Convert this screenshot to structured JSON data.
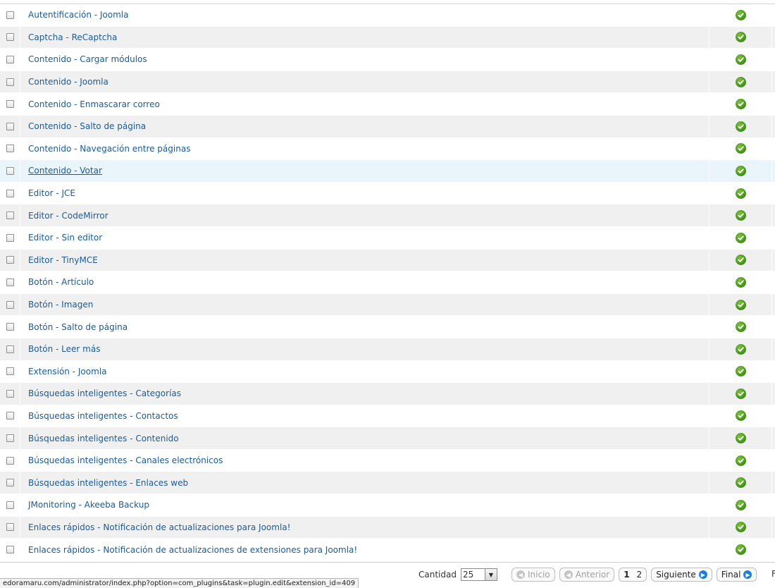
{
  "plugins": [
    {
      "name": "Autentificación - Joomla",
      "enabled": true
    },
    {
      "name": "Captcha - ReCaptcha",
      "enabled": true
    },
    {
      "name": "Contenido - Cargar módulos",
      "enabled": true
    },
    {
      "name": "Contenido - Joomla",
      "enabled": true
    },
    {
      "name": "Contenido - Enmascarar correo",
      "enabled": true
    },
    {
      "name": "Contenido - Salto de página",
      "enabled": true
    },
    {
      "name": "Contenido - Navegación entre páginas",
      "enabled": true
    },
    {
      "name": "Contenido - Votar",
      "enabled": true
    },
    {
      "name": "Editor - JCE",
      "enabled": true
    },
    {
      "name": "Editor - CodeMirror",
      "enabled": true
    },
    {
      "name": "Editor - Sin editor",
      "enabled": true
    },
    {
      "name": "Editor - TinyMCE",
      "enabled": true
    },
    {
      "name": "Botón - Artículo",
      "enabled": true
    },
    {
      "name": "Botón - Imagen",
      "enabled": true
    },
    {
      "name": "Botón - Salto de página",
      "enabled": true
    },
    {
      "name": "Botón - Leer más",
      "enabled": true
    },
    {
      "name": "Extensión - Joomla",
      "enabled": true
    },
    {
      "name": "Búsquedas inteligentes - Categorías",
      "enabled": true
    },
    {
      "name": "Búsquedas inteligentes - Contactos",
      "enabled": true
    },
    {
      "name": "Búsquedas inteligentes - Contenido",
      "enabled": true
    },
    {
      "name": "Búsquedas inteligentes - Canales electrónicos",
      "enabled": true
    },
    {
      "name": "Búsquedas inteligentes - Enlaces web",
      "enabled": true
    },
    {
      "name": "JMonitoring - Akeeba Backup",
      "enabled": true
    },
    {
      "name": "Enlaces rápidos - Notificación de actualizaciones para Joomla!",
      "enabled": true
    },
    {
      "name": "Enlaces rápidos - Notificación de actualizaciones de extensiones para Joomla!",
      "enabled": true
    }
  ],
  "hovered_index": 7,
  "icons": {
    "status": "check-circle-icon",
    "first": "arrow-left-circle-icon",
    "prev": "arrow-left-circle-icon",
    "next": "arrow-right-circle-icon",
    "last": "arrow-right-circle-icon",
    "limit_dropdown": "chevron-down-icon"
  },
  "colors": {
    "link": "#1a5b96",
    "enabled": "#3b8a14",
    "row_alt": "#f0f0f0",
    "row_hover": "#e9f4fb",
    "pager_active": "#1f7fd1"
  },
  "pagination": {
    "limit_label": "Cantidad",
    "limit_value": "25",
    "start_label": "Inicio",
    "prev_label": "Anterior",
    "pages": [
      "1",
      "2"
    ],
    "current_page": "1",
    "next_label": "Siguiente",
    "end_label": "Final",
    "trailing_text": "F"
  },
  "status_bar": {
    "url": "edoramaru.com/administrator/index.php?option=com_plugins&task=plugin.edit&extension_id=409"
  }
}
